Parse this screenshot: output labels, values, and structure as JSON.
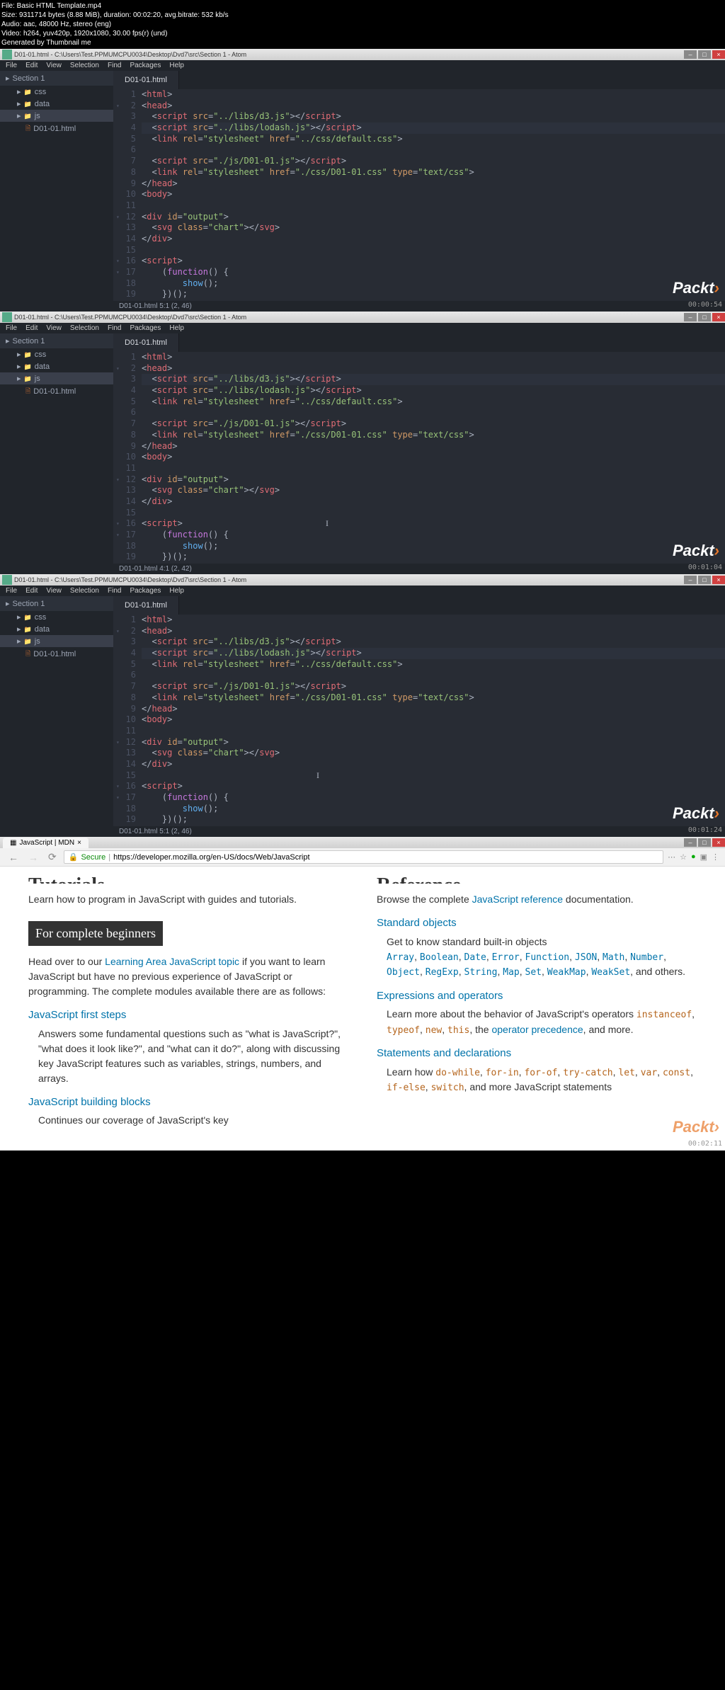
{
  "top_info": {
    "file": "File: Basic HTML Template.mp4",
    "size": "Size: 9311714 bytes (8.88 MiB), duration: 00:02:20, avg.bitrate: 532 kb/s",
    "audio": "Audio: aac, 48000 Hz, stereo (eng)",
    "video": "Video: h264, yuv420p, 1920x1080, 30.00 fps(r) (und)",
    "gen": "Generated by Thumbnail me"
  },
  "atom": {
    "title_path": "D01-01.html - C:\\Users\\Test.PPMUMCPU0034\\Desktop\\Dvd7\\src\\Section 1 - Atom",
    "menus": [
      "File",
      "Edit",
      "View",
      "Selection",
      "Find",
      "Packages",
      "Help"
    ],
    "project": "Section 1",
    "tree": [
      {
        "label": "css",
        "type": "folder"
      },
      {
        "label": "data",
        "type": "folder"
      },
      {
        "label": "js",
        "type": "folder",
        "active": true
      },
      {
        "label": "D01-01.html",
        "type": "file",
        "level": 2
      }
    ],
    "tab_name": "D01-01.html"
  },
  "snap1": {
    "status": "D01-01.html    5:1    (2, 46)",
    "time": "00:00:54",
    "hl_line": 4
  },
  "snap2": {
    "status": "D01-01.html    4:1    (2, 42)",
    "time": "00:01:04",
    "hl_line": 3
  },
  "snap3": {
    "status": "D01-01.html    5:1    (2, 46)",
    "time": "00:01:24",
    "hl_line": 4
  },
  "packt": "Packt",
  "browser": {
    "tab": "JavaScript | MDN",
    "secure": "Secure",
    "url": "https://developer.mozilla.org/en-US/docs/Web/JavaScript",
    "time": "00:02:11",
    "tutorials_h": "Tutorials",
    "tutorials_p": "Learn how to program in JavaScript with guides and tutorials.",
    "beginners_h": "For complete beginners",
    "beginners_p1_a": "Head over to our ",
    "beginners_p1_link": "Learning Area JavaScript topic",
    "beginners_p1_b": " if you want to learn JavaScript but have no previous experience of JavaScript or programming. The complete modules available there are as follows:",
    "first_steps_h": "JavaScript first steps",
    "first_steps_p": "Answers some fundamental questions such as \"what is JavaScript?\", \"what does it look like?\", and \"what can it do?\", along with discussing key JavaScript features such as variables, strings, numbers, and arrays.",
    "building_h": "JavaScript building blocks",
    "building_p": "Continues our coverage of JavaScript's key",
    "reference_h": "Reference",
    "reference_p_a": "Browse the complete ",
    "reference_p_link": "JavaScript reference",
    "reference_p_b": " documentation.",
    "std_obj_h": "Standard objects",
    "std_obj_p": "Get to know standard built-in objects",
    "std_objs": [
      "Array",
      "Boolean",
      "Date",
      "Error",
      "Function",
      "JSON",
      "Math",
      "Number",
      "Object",
      "RegExp",
      "String",
      "Map",
      "Set",
      "WeakMap",
      "WeakSet"
    ],
    "std_obj_end": ", and others.",
    "expr_h": "Expressions and operators",
    "expr_p1": "Learn more about the behavior of JavaScript's operators ",
    "expr_kw": [
      "instanceof",
      "typeof",
      "new",
      "this"
    ],
    "expr_p2": ", the ",
    "expr_link": "operator precedence",
    "expr_p3": ", and more.",
    "stmt_h": "Statements and declarations",
    "stmt_p1": "Learn how ",
    "stmt_kw": [
      "do-while",
      "for-in",
      "for-of",
      "try-catch",
      "let",
      "var",
      "const",
      "if-else",
      "switch"
    ],
    "stmt_p2": ", and more JavaScript statements"
  }
}
